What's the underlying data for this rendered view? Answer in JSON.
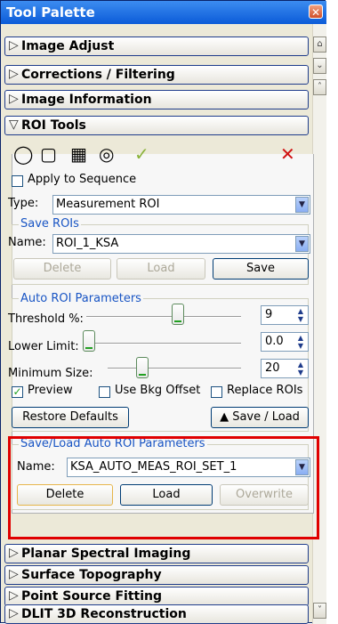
{
  "window": {
    "title": "Tool Palette",
    "close": "✕"
  },
  "sections": {
    "image_adjust": "Image Adjust",
    "corrections": "Corrections / Filtering",
    "image_info": "Image Information",
    "roi_tools": "ROI Tools",
    "planar": "Planar Spectral Imaging",
    "surface": "Surface Topography",
    "point_source": "Point Source Fitting",
    "dlit": "DLIT 3D Reconstruction"
  },
  "roi": {
    "apply_sequence": "Apply to Sequence",
    "type_label": "Type:",
    "type_value": "Measurement ROI",
    "save_group": "Save ROIs",
    "name_label": "Name:",
    "name_value": "ROI_1_KSA",
    "buttons": {
      "delete": "Delete",
      "load": "Load",
      "save": "Save"
    },
    "auto_group": "Auto ROI Parameters",
    "threshold_label": "Threshold %:",
    "threshold_value": "9",
    "lower_label": "Lower Limit:",
    "lower_value": "0.0",
    "minsize_label": "Minimum Size:",
    "minsize_value": "20",
    "preview": "Preview",
    "bkg_offset": "Use Bkg Offset",
    "replace": "Replace ROIs",
    "restore": "Restore Defaults",
    "saveload": "▲ Save / Load",
    "saveload_group": "Save/Load Auto ROI Parameters",
    "auto_name_label": "Name:",
    "auto_name_value": "KSA_AUTO_MEAS_ROI_SET_1",
    "auto_delete": "Delete",
    "auto_load": "Load",
    "auto_overwrite": "Overwrite"
  }
}
